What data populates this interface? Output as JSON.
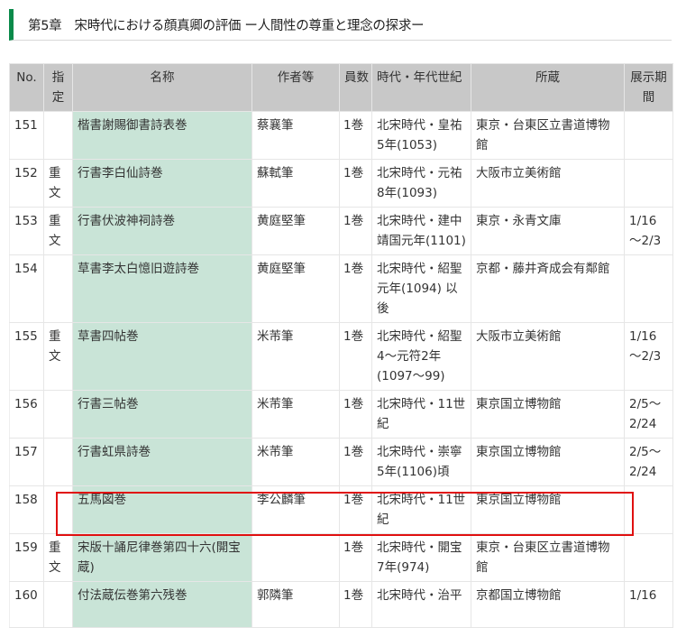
{
  "chapter_title": "第5章　宋時代における顔真卿の評価 ー人間性の尊重と理念の探求ー",
  "headers": {
    "no": "No.",
    "designation": "指定",
    "name": "名称",
    "author": "作者等",
    "quantity": "員数",
    "period": "時代・年代世紀",
    "collection": "所蔵",
    "exhibit": "展示期間"
  },
  "rows": [
    {
      "no": "151",
      "designation": "",
      "name": "楷書謝賜御書詩表巻",
      "author": "蔡襄筆",
      "quantity": "1巻",
      "period": "北宋時代・皇祐5年(1053)",
      "collection": "東京・台東区立書道博物館",
      "exhibit": ""
    },
    {
      "no": "152",
      "designation": "重文",
      "name": "行書李白仙詩巻",
      "author": "蘇軾筆",
      "quantity": "1巻",
      "period": "北宋時代・元祐8年(1093)",
      "collection": "大阪市立美術館",
      "exhibit": ""
    },
    {
      "no": "153",
      "designation": "重文",
      "name": "行書伏波神祠詩巻",
      "author": "黄庭堅筆",
      "quantity": "1巻",
      "period": "北宋時代・建中靖国元年(1101)",
      "collection": "東京・永青文庫",
      "exhibit": "1/16～2/3"
    },
    {
      "no": "154",
      "designation": "",
      "name": "草書李太白憶旧遊詩巻",
      "author": "黄庭堅筆",
      "quantity": "1巻",
      "period": "北宋時代・紹聖元年(1094) 以後",
      "collection": "京都・藤井斉成会有鄰館",
      "exhibit": ""
    },
    {
      "no": "155",
      "designation": "重文",
      "name": "草書四帖巻",
      "author": "米芾筆",
      "quantity": "1巻",
      "period": "北宋時代・紹聖4～元符2年(1097～99)",
      "collection": "大阪市立美術館",
      "exhibit": "1/16～2/3"
    },
    {
      "no": "156",
      "designation": "",
      "name": "行書三帖巻",
      "author": "米芾筆",
      "quantity": "1巻",
      "period": "北宋時代・11世紀",
      "collection": "東京国立博物館",
      "exhibit": "2/5～2/24"
    },
    {
      "no": "157",
      "designation": "",
      "name": "行書虹県詩巻",
      "author": "米芾筆",
      "quantity": "1巻",
      "period": "北宋時代・崇寧5年(1106)頃",
      "collection": "東京国立博物館",
      "exhibit": "2/5～2/24"
    },
    {
      "no": "158",
      "designation": "",
      "name": "五馬図巻",
      "author": "李公麟筆",
      "quantity": "1巻",
      "period": "北宋時代・11世紀",
      "collection": "東京国立博物館",
      "exhibit": ""
    },
    {
      "no": "159",
      "designation": "重文",
      "name": "宋版十誦尼律巻第四十六(開宝蔵)",
      "author": "",
      "quantity": "1巻",
      "period": "北宋時代・開宝7年(974)",
      "collection": "東京・台東区立書道博物館",
      "exhibit": ""
    },
    {
      "no": "160",
      "designation": "",
      "name": "付法蔵伝巻第六残巻",
      "author": "郭隣筆",
      "quantity": "1巻",
      "period": "北宋時代・治平",
      "collection": "京都国立博物館",
      "exhibit": "1/16"
    }
  ],
  "highlighted_row": "158",
  "colors": {
    "accent": "#0a8a4a",
    "name_bg": "#c9e4d7",
    "header_bg": "#c8c8c8",
    "highlight": "#e01010"
  }
}
